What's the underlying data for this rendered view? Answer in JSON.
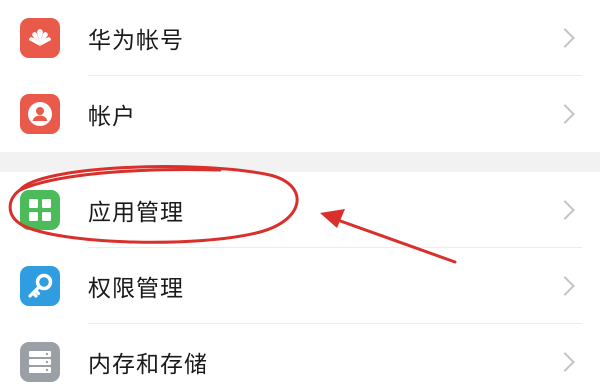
{
  "settings": {
    "items": [
      {
        "label": "华为帐号",
        "icon": "huawei-logo-icon",
        "color": "#ea5a4a"
      },
      {
        "label": "帐户",
        "icon": "user-icon",
        "color": "#ea5a4a"
      },
      {
        "label": "应用管理",
        "icon": "apps-grid-icon",
        "color": "#4cbb5a"
      },
      {
        "label": "权限管理",
        "icon": "key-icon",
        "color": "#2f9de0"
      },
      {
        "label": "内存和存储",
        "icon": "storage-icon",
        "color": "#9aa0a6"
      }
    ]
  },
  "annotation": {
    "highlight_color": "#d9302c",
    "target_item": "应用管理"
  }
}
